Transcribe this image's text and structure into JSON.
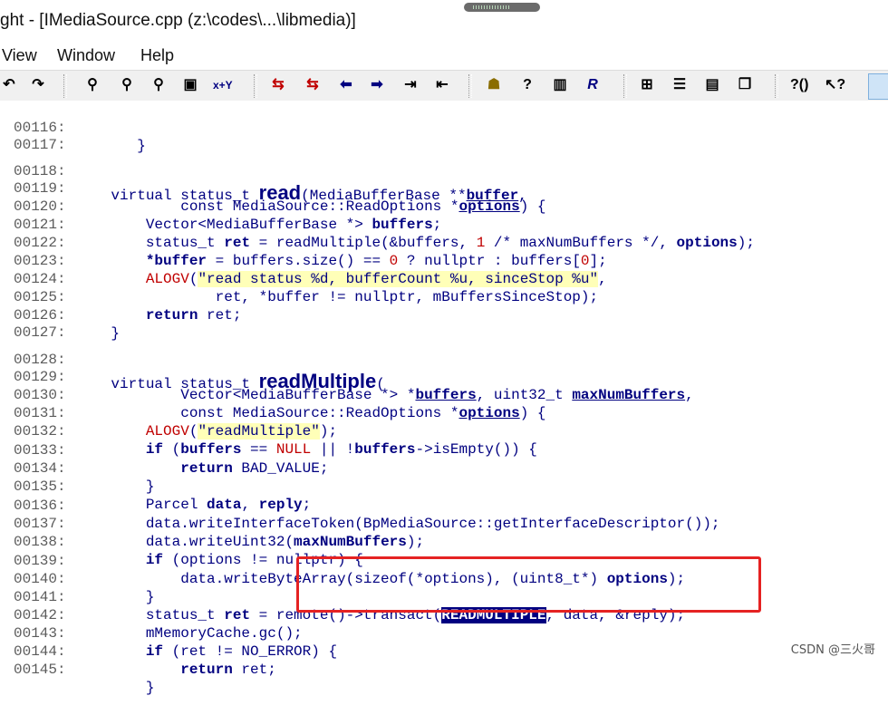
{
  "window": {
    "title": "ght - [IMediaSource.cpp (z:\\codes\\...\\libmedia)]"
  },
  "menu": [
    "View",
    "Window",
    "Help"
  ],
  "toolbar": {
    "icons": [
      "undo-icon",
      "redo-icon",
      "find-icon",
      "find-next-icon",
      "find-prev-icon",
      "replace-icon",
      "xy-icon",
      "bookmark-prev-icon",
      "bookmark-next-icon",
      "arrow-left-icon",
      "arrow-right-icon",
      "indent-icon",
      "outdent-icon",
      "symbol-info-icon",
      "help-info-icon",
      "book-icon",
      "r-icon",
      "window-grid-icon",
      "window-list-icon",
      "window-split-icon",
      "window-cascade-icon",
      "context-help-icon",
      "pointer-help-icon",
      "active-tool-icon"
    ],
    "xy_label": "x+Y"
  },
  "code": {
    "lines": [
      {
        "n": "00116:",
        "t": "       }"
      },
      {
        "n": "00117:",
        "t": ""
      },
      {
        "n": "00118:",
        "t": "    virtual status_t read(MediaBufferBase **buffer,"
      },
      {
        "n": "00119:",
        "t": "            const MediaSource::ReadOptions *options) {"
      },
      {
        "n": "00120:",
        "t": "        Vector<MediaBufferBase *> buffers;"
      },
      {
        "n": "00121:",
        "t": "        status_t ret = readMultiple(&buffers, 1 /* maxNumBuffers */, options);"
      },
      {
        "n": "00122:",
        "t": "        *buffer = buffers.size() == 0 ? nullptr : buffers[0];"
      },
      {
        "n": "00123:",
        "t": "        ALOGV(\"read status %d, bufferCount %u, sinceStop %u\","
      },
      {
        "n": "00124:",
        "t": "                ret, *buffer != nullptr, mBuffersSinceStop);"
      },
      {
        "n": "00125:",
        "t": "        return ret;"
      },
      {
        "n": "00126:",
        "t": "    }"
      },
      {
        "n": "00127:",
        "t": ""
      },
      {
        "n": "00128:",
        "t": "    virtual status_t readMultiple("
      },
      {
        "n": "00129:",
        "t": "            Vector<MediaBufferBase *> *buffers, uint32_t maxNumBuffers,"
      },
      {
        "n": "00130:",
        "t": "            const MediaSource::ReadOptions *options) {"
      },
      {
        "n": "00131:",
        "t": "        ALOGV(\"readMultiple\");"
      },
      {
        "n": "00132:",
        "t": "        if (buffers == NULL || !buffers->isEmpty()) {"
      },
      {
        "n": "00133:",
        "t": "            return BAD_VALUE;"
      },
      {
        "n": "00134:",
        "t": "        }"
      },
      {
        "n": "00135:",
        "t": "        Parcel data, reply;"
      },
      {
        "n": "00136:",
        "t": "        data.writeInterfaceToken(BpMediaSource::getInterfaceDescriptor());"
      },
      {
        "n": "00137:",
        "t": "        data.writeUint32(maxNumBuffers);"
      },
      {
        "n": "00138:",
        "t": "        if (options != nullptr) {"
      },
      {
        "n": "00139:",
        "t": "            data.writeByteArray(sizeof(*options), (uint8_t*) options);"
      },
      {
        "n": "00140:",
        "t": "        }"
      },
      {
        "n": "00141:",
        "t": "        status_t ret = remote()->transact(READMULTIPLE, data, &reply);"
      },
      {
        "n": "00142:",
        "t": "        mMemoryCache.gc();"
      },
      {
        "n": "00143:",
        "t": "        if (ret != NO_ERROR) {"
      },
      {
        "n": "00144:",
        "t": "            return ret;"
      },
      {
        "n": "00145:",
        "t": "        }"
      }
    ],
    "selected_token": "READMULTIPLE"
  },
  "watermark": "CSDN @三火哥",
  "colors": {
    "code_text": "#000080",
    "selection_bg": "#000080",
    "annotation_box": "#e52222",
    "string_highlight": "#ffffb8"
  }
}
